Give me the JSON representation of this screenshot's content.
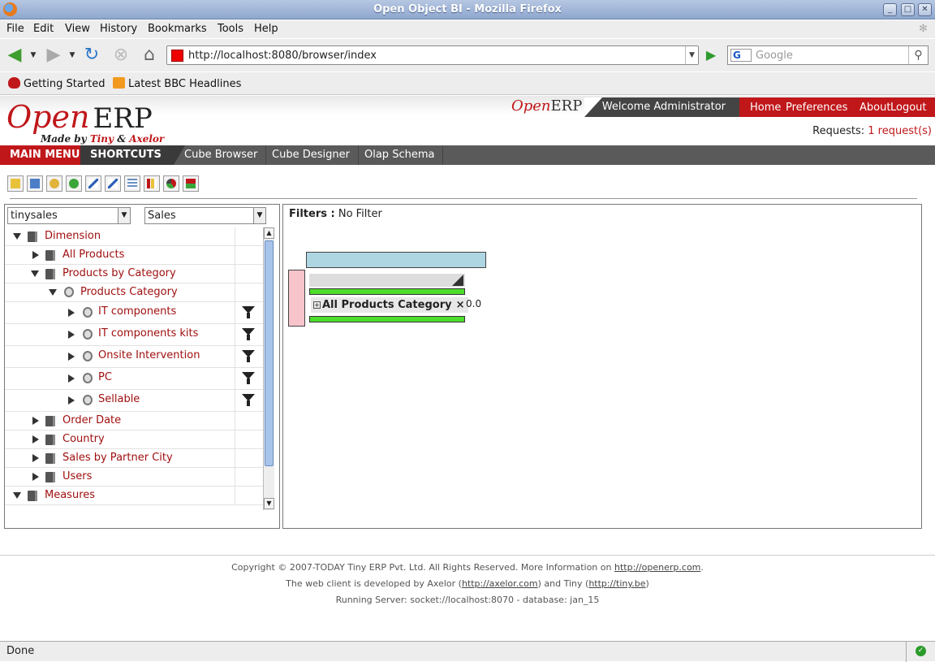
{
  "window": {
    "title": "Open Object BI - Mozilla Firefox"
  },
  "menu": [
    "File",
    "Edit",
    "View",
    "History",
    "Bookmarks",
    "Tools",
    "Help"
  ],
  "nav": {
    "url": "http://localhost:8080/browser/index",
    "search_placeholder": "Google",
    "search_engine": "G"
  },
  "bookmarks": [
    "Getting Started",
    "Latest BBC Headlines"
  ],
  "erp": {
    "logo_open": "Open",
    "logo_erp": "ERP",
    "made_by_prefix": "Made by",
    "made_by_tiny": "Tiny",
    "made_by_amp": "&",
    "made_by_axelor": "Axelor",
    "small_logo_open": "Open",
    "small_logo_erp": "ERP",
    "welcome": "Welcome Administrator",
    "links": [
      "Home",
      "Preferences",
      "About",
      "Logout"
    ],
    "requests_label": "Requests:",
    "requests_link": "1 request(s)"
  },
  "mainbar": {
    "main_menu": "MAIN MENU",
    "shortcuts_label": "SHORTCUTS",
    "shortcuts": [
      "Cube Browser",
      "Cube Designer",
      "Olap Schema"
    ]
  },
  "left": {
    "schema": "tinysales",
    "cube": "Sales",
    "tree": [
      {
        "label": "Dimension"
      },
      {
        "label": "All Products"
      },
      {
        "label": "Products by Category"
      },
      {
        "label": "Products Category"
      },
      {
        "label": "IT components"
      },
      {
        "label": "IT components kits"
      },
      {
        "label": "Onsite Intervention"
      },
      {
        "label": "PC"
      },
      {
        "label": "Sellable"
      },
      {
        "label": "Order Date"
      },
      {
        "label": "Country"
      },
      {
        "label": "Sales by Partner City"
      },
      {
        "label": "Users"
      },
      {
        "label": "Measures"
      }
    ]
  },
  "right": {
    "filters_label": "Filters :",
    "filters_value": "No Filter",
    "chip_label": "All Products Category",
    "chip_close": "×",
    "value": "0.0"
  },
  "footer": {
    "line1_text": "Copyright © 2007-TODAY Tiny ERP Pvt. Ltd. All Rights Reserved. More Information on",
    "line1_link": "http://openerp.com",
    "line1_end": ".",
    "line2_a": "The web client is developed by Axelor (",
    "line2_link1": "http://axelor.com",
    "line2_b": ") and Tiny (",
    "line2_link2": "http://tiny.be",
    "line2_c": ")",
    "line3": "Running Server: socket://localhost:8070 - database: jan_15"
  },
  "status": {
    "text": "Done"
  },
  "colors": {
    "brand_red": "#c0171a",
    "dark_bar": "#5a5a5a",
    "green": "#4dde2c",
    "pink": "#f7c4cc",
    "blue": "#aed6e2"
  }
}
